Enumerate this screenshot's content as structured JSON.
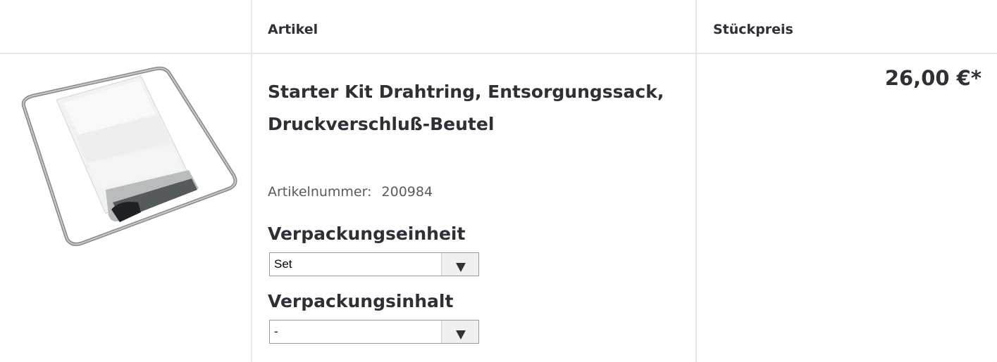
{
  "header": {
    "col_article": "Artikel",
    "col_unit_price": "Stückpreis"
  },
  "product": {
    "image_icon": "product-bag-with-wire-ring",
    "title": "Starter Kit Drahtring, Entsorgungssack, Druckverschluß-Beutel",
    "article_number_label": "Artikelnummer:",
    "article_number": "200984",
    "price": "26,00 €*"
  },
  "options": {
    "packaging_unit_label": "Verpackungseinheit",
    "packaging_unit_value": "Set",
    "packaging_content_label": "Verpackungsinhalt",
    "packaging_content_value": "-"
  }
}
